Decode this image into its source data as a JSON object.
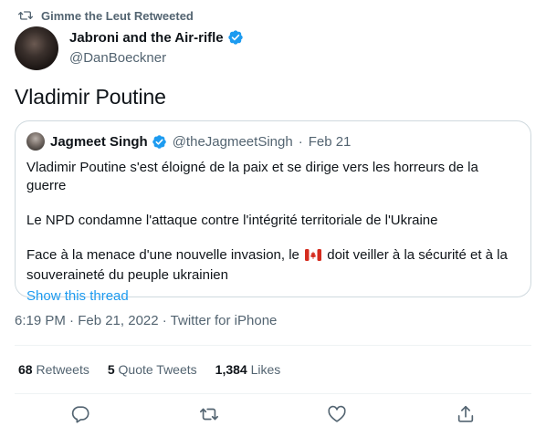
{
  "retweet_header": {
    "text": "Gimme the Leut Retweeted",
    "icon": "retweet-icon"
  },
  "author": {
    "display_name": "Jabroni and the Air-rifle",
    "handle": "@DanBoeckner",
    "verified": true
  },
  "tweet": {
    "text": "Vladimir Poutine"
  },
  "quoted_tweet": {
    "display_name": "Jagmeet Singh",
    "handle": "@theJagmeetSingh",
    "separator": "·",
    "date": "Feb 21",
    "verified": true,
    "paragraph_1": "Vladimir Poutine s'est éloigné de la paix et se dirige vers les horreurs de la guerre",
    "paragraph_2": "Le NPD condamne l'attaque contre l'intégrité territoriale de l'Ukraine",
    "paragraph_3_before_flag": "Face à la menace d'une nouvelle invasion, le",
    "paragraph_3_after_flag": "doit veiller à la sécurité et à la souveraineté du peuple ukrainien",
    "show_thread": "Show this thread"
  },
  "meta": {
    "text": "6:19 PM · Feb 21, 2022 · Twitter for iPhone"
  },
  "stats": {
    "retweets_count": "68",
    "retweets_label": "Retweets",
    "quotes_count": "5",
    "quotes_label": "Quote Tweets",
    "likes_count": "1,384",
    "likes_label": "Likes"
  },
  "actions": [
    "reply-icon",
    "retweet-icon",
    "like-icon",
    "share-icon"
  ],
  "colors": {
    "text_primary": "#0f1419",
    "text_secondary": "#536471",
    "link_blue": "#1d9bf0",
    "verified_blue": "#1d9bf0",
    "border": "#cfd9de",
    "divider": "#eff3f4",
    "flag_red": "#d52b1e"
  }
}
